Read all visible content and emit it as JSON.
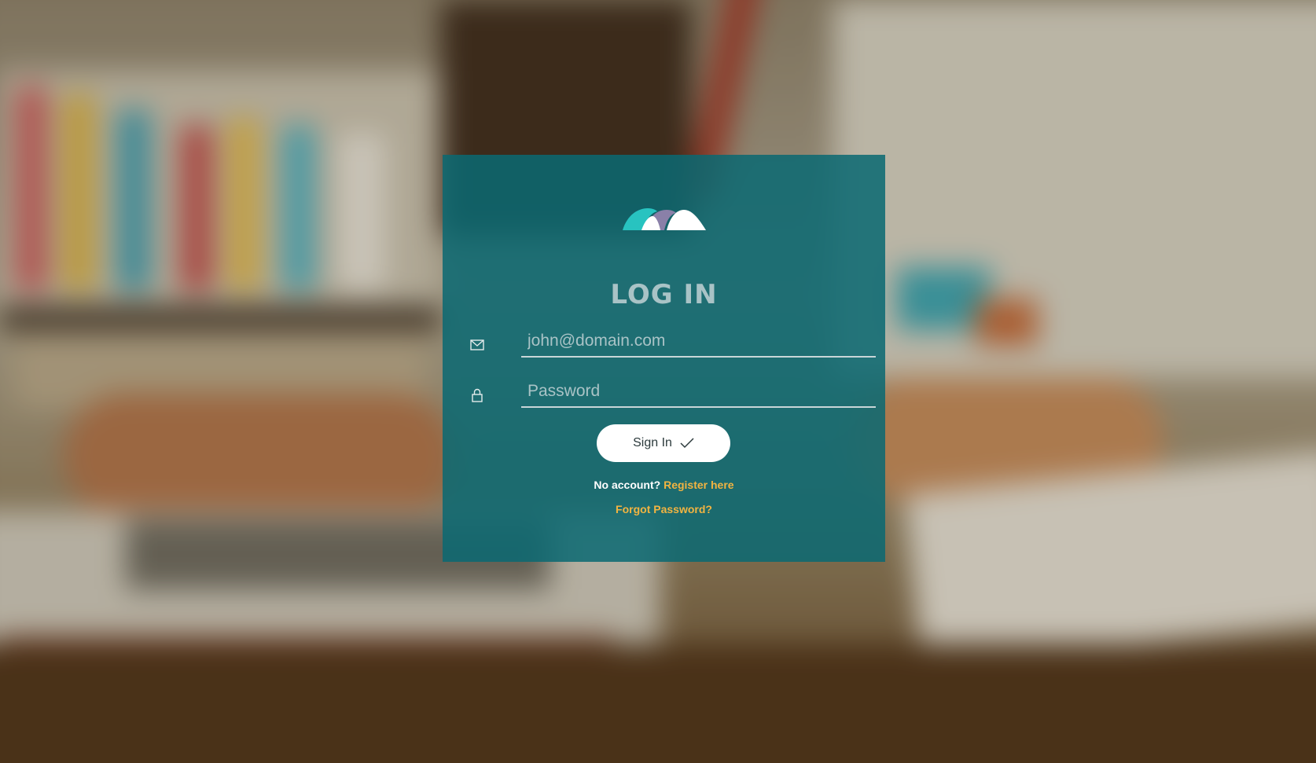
{
  "page": {
    "title": "LOG IN",
    "logo_name": "brand-logo"
  },
  "form": {
    "email_placeholder": "john@domain.com",
    "password_placeholder": "Password",
    "email_icon": "envelope-icon",
    "password_icon": "lock-icon",
    "sign_in_label": "Sign In",
    "sign_in_icon": "check-icon"
  },
  "links": {
    "no_account_text": "No account?",
    "register_label": "Register here",
    "forgot_label": "Forgot Password?"
  },
  "colors": {
    "card": "#0a6972",
    "title": "#a9c3c6",
    "link": "#f2b441",
    "logo_teal": "#28c3c0",
    "logo_purple": "#8a80a8",
    "logo_white": "#ffffff"
  }
}
